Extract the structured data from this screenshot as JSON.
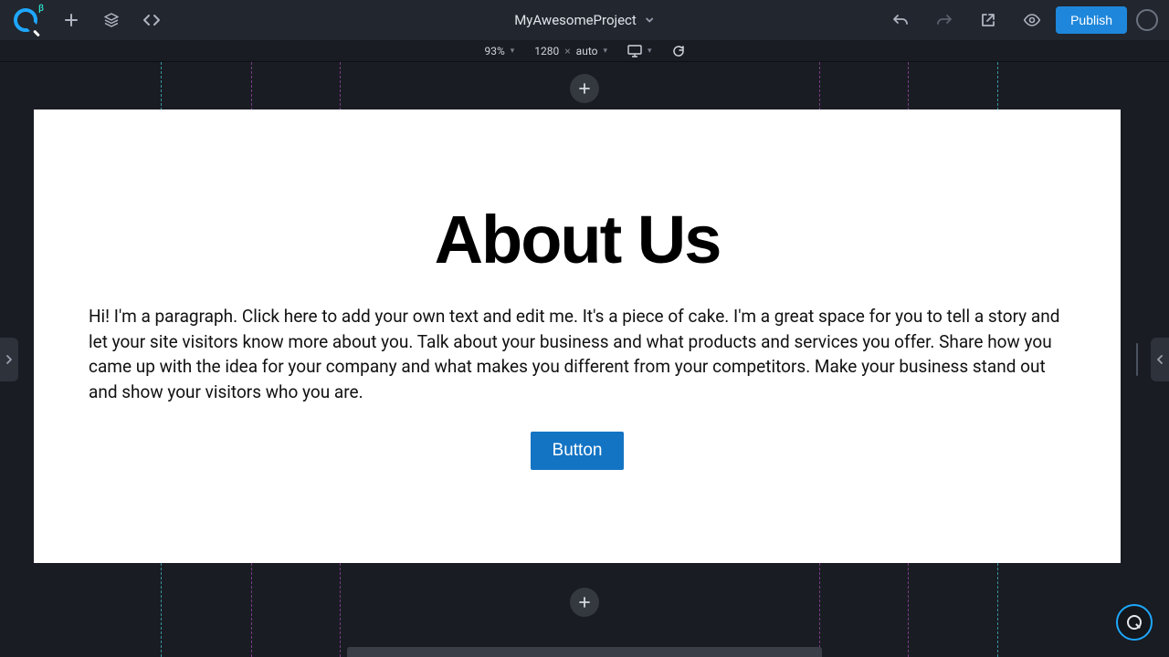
{
  "header": {
    "beta_tag": "β",
    "project_name": "MyAwesomeProject",
    "publish_label": "Publish"
  },
  "subtoolbar": {
    "zoom": "93%",
    "width": "1280",
    "times": "×",
    "height": "auto"
  },
  "canvas": {
    "title": "About Us",
    "paragraph": "Hi! I'm a paragraph. Click here to add your own text and edit me. It's a piece of cake. I'm a great space for you to tell a story and let your site visitors know more about you. Talk about your business and what products and services you offer. Share how you came up with the idea for your company and what makes you different from your competitors. Make your business stand out and show your visitors who you are.",
    "button_label": "Button"
  },
  "colors": {
    "accent": "#1ea7fd",
    "publish": "#1e87db",
    "canvas_button": "#1474c4"
  }
}
